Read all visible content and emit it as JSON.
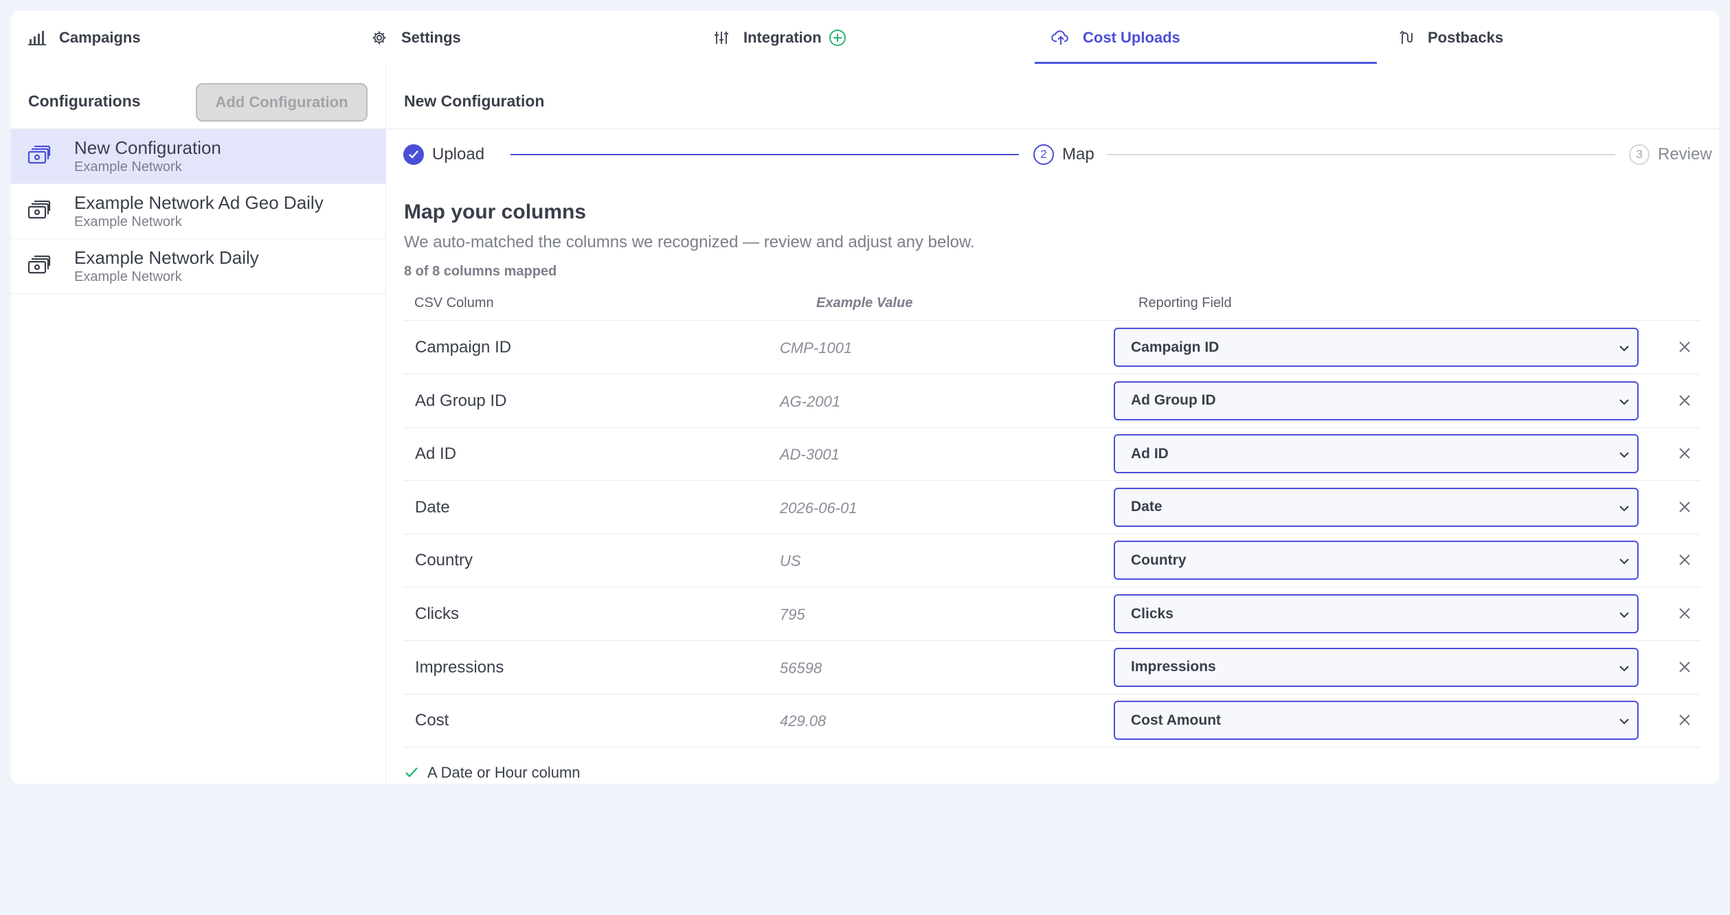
{
  "tabs": [
    {
      "label": "Campaigns",
      "icon": "bar-chart-icon"
    },
    {
      "label": "Settings",
      "icon": "gear-icon"
    },
    {
      "label": "Integration",
      "icon": "sliders-icon"
    },
    {
      "label": "Cost Uploads",
      "icon": "cloud-upload-icon"
    },
    {
      "label": "Postbacks",
      "icon": "route-icon"
    }
  ],
  "active_tab": "Cost Uploads",
  "sidebar": {
    "title": "Configurations",
    "add_button": "Add Configuration",
    "items": [
      {
        "name": "New Configuration",
        "network": "Example Network"
      },
      {
        "name": "Example Network Ad Geo Daily",
        "network": "Example Network"
      },
      {
        "name": "Example Network Daily",
        "network": "Example Network"
      }
    ]
  },
  "main": {
    "title": "New Configuration",
    "steps": [
      {
        "number": "1",
        "label": "Upload",
        "state": "done"
      },
      {
        "number": "2",
        "label": "Map",
        "state": "current"
      },
      {
        "number": "3",
        "label": "Review",
        "state": "todo"
      }
    ],
    "section_title": "Map your columns",
    "section_desc": "We auto-matched the columns we recognized — review and adjust any below.",
    "mapped_count": "8 of 8 columns mapped",
    "columns": {
      "csv": "CSV Column",
      "example": "Example Value",
      "field": "Reporting Field"
    },
    "rows": [
      {
        "csv": "Campaign ID",
        "example": "CMP-1001",
        "field": "Campaign ID"
      },
      {
        "csv": "Ad Group ID",
        "example": "AG-2001",
        "field": "Ad Group ID"
      },
      {
        "csv": "Ad ID",
        "example": "AD-3001",
        "field": "Ad ID"
      },
      {
        "csv": "Date",
        "example": "2026-06-01",
        "field": "Date"
      },
      {
        "csv": "Country",
        "example": "US",
        "field": "Country"
      },
      {
        "csv": "Clicks",
        "example": "795",
        "field": "Clicks"
      },
      {
        "csv": "Impressions",
        "example": "56598",
        "field": "Impressions"
      },
      {
        "csv": "Cost",
        "example": "429.08",
        "field": "Cost Amount"
      }
    ],
    "requirement": "A Date or Hour column"
  },
  "colors": {
    "accent": "#4a4fd8",
    "success": "#2bb673",
    "selected_row": "#e3e6fb",
    "page_bg": "#f1f3fb"
  }
}
